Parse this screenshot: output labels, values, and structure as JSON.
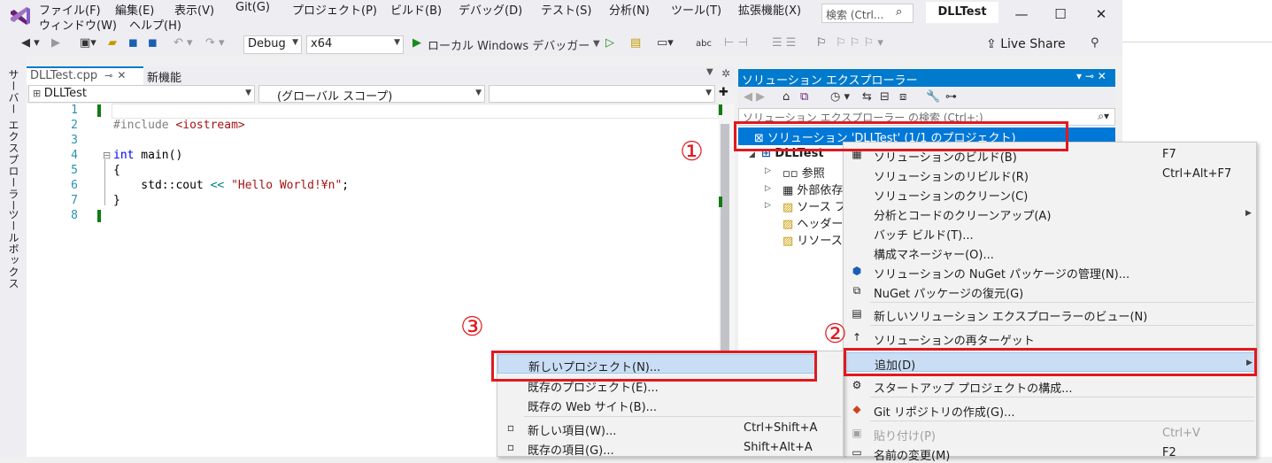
{
  "menu": {
    "items": [
      "ファイル(F)",
      "編集(E)",
      "表示(V)",
      "Git(G)",
      "プロジェクト(P)",
      "ビルド(B)",
      "デバッグ(D)",
      "テスト(S)",
      "分析(N)",
      "ツール(T)",
      "拡張機能(X)"
    ],
    "items2": [
      "ウィンドウ(W)",
      "ヘルプ(H)"
    ],
    "search_placeholder": "検索 (Ctrl...",
    "title": "DLLTest"
  },
  "toolbar": {
    "config": "Debug",
    "platform": "x64",
    "run_label": "ローカル Windows デバッガー",
    "live_share": "Live Share"
  },
  "rail": {
    "server_explorer": "サーバー エクスプローラー",
    "toolbox": "ツールボックス"
  },
  "editor": {
    "tab_active": "DLLTest.cpp",
    "tab_other": "新機能",
    "nav_project": "DLLTest",
    "nav_scope": "(グローバル スコープ)",
    "lines": [
      "1",
      "2",
      "3",
      "4",
      "5",
      "6",
      "7",
      "8"
    ],
    "code": {
      "include_kw": "#include",
      "include_file": "<iostream>",
      "int_kw": "int",
      "main_sig": " main()",
      "open_brace": "{",
      "cout": "    std::cout ",
      "op": "<<",
      "str": "\"Hello World!¥n\"",
      "semi": ";",
      "close_brace": "}"
    }
  },
  "solution_explorer": {
    "title": "ソリューション エクスプローラー",
    "search_placeholder": "ソリューション エクスプローラー の検索 (Ctrl+;)",
    "solution_row": "ソリューション 'DLLTest' (1/1 のプロジェクト)",
    "tree": [
      "DLLTest",
      "参照",
      "外部依存",
      "ソース フ",
      "ヘッダー",
      "リソース"
    ]
  },
  "context_menu": {
    "items": [
      {
        "label": "ソリューションのビルド(B)",
        "shortcut": "F7"
      },
      {
        "label": "ソリューションのリビルド(R)",
        "shortcut": "Ctrl+Alt+F7"
      },
      {
        "label": "ソリューションのクリーン(C)",
        "shortcut": ""
      },
      {
        "label": "分析とコードのクリーンアップ(A)",
        "shortcut": ""
      },
      {
        "label": "バッチ ビルド(T)...",
        "shortcut": ""
      },
      {
        "label": "構成マネージャー(O)...",
        "shortcut": ""
      },
      {
        "label": "ソリューションの NuGet パッケージの管理(N)...",
        "shortcut": ""
      },
      {
        "label": "NuGet パッケージの復元(G)",
        "shortcut": ""
      },
      {
        "label": "新しいソリューション エクスプローラーのビュー(N)",
        "shortcut": ""
      },
      {
        "label": "ソリューションの再ターゲット",
        "shortcut": ""
      },
      {
        "label": "追加(D)",
        "shortcut": ""
      },
      {
        "label": "スタートアップ プロジェクトの構成...",
        "shortcut": ""
      },
      {
        "label": "Git リポジトリの作成(G)...",
        "shortcut": ""
      },
      {
        "label": "貼り付け(P)",
        "shortcut": "Ctrl+V"
      },
      {
        "label": "名前の変更(M)",
        "shortcut": "F2"
      }
    ]
  },
  "add_submenu": {
    "items": [
      {
        "label": "新しいプロジェクト(N)...",
        "shortcut": ""
      },
      {
        "label": "既存のプロジェクト(E)...",
        "shortcut": ""
      },
      {
        "label": "既存の Web サイト(B)...",
        "shortcut": ""
      },
      {
        "label": "新しい項目(W)...",
        "shortcut": "Ctrl+Shift+A"
      },
      {
        "label": "既存の項目(G)...",
        "shortcut": "Shift+Alt+A"
      }
    ]
  },
  "annotations": {
    "step1": "①",
    "step2": "②",
    "step3": "③"
  },
  "colors": {
    "accent": "#007acc",
    "selection": "#0078d7",
    "annotation": "#e0191f",
    "highlight": "#c9def5"
  }
}
